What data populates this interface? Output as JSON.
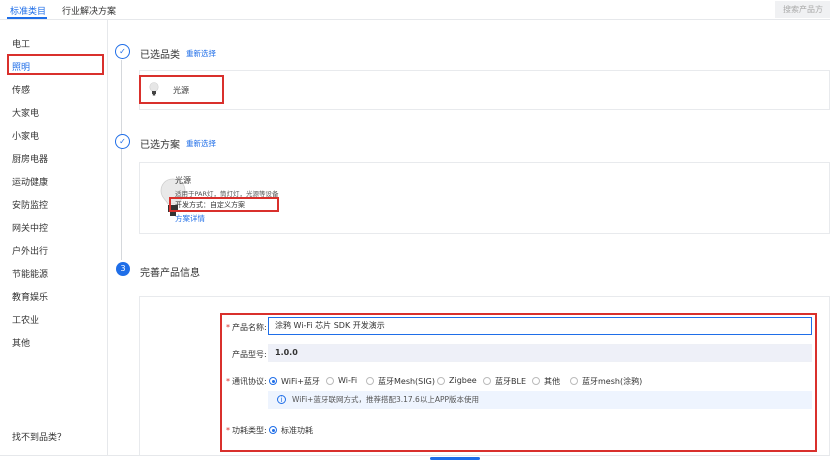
{
  "tabs": [
    {
      "label": "标准类目",
      "active": true
    },
    {
      "label": "行业解决方案",
      "active": false
    }
  ],
  "search": {
    "placeholder": "搜索产品方"
  },
  "sidebar": {
    "items": [
      {
        "label": "电工"
      },
      {
        "label": "照明",
        "active": true
      },
      {
        "label": "传感"
      },
      {
        "label": "大家电"
      },
      {
        "label": "小家电"
      },
      {
        "label": "厨房电器"
      },
      {
        "label": "运动健康"
      },
      {
        "label": "安防监控"
      },
      {
        "label": "网关中控"
      },
      {
        "label": "户外出行"
      },
      {
        "label": "节能能源"
      },
      {
        "label": "教育娱乐"
      },
      {
        "label": "工农业"
      },
      {
        "label": "其他"
      }
    ],
    "bottom": "找不到品类？"
  },
  "step1": {
    "title": "已选品类",
    "link": "重新选择",
    "selected": "光源"
  },
  "step2": {
    "title": "已选方案",
    "link": "重新选择",
    "name": "光源",
    "desc": "适用于PAR灯，筒灯灯，光源等设备",
    "dev_mode": "开发方式：自定义方案",
    "detail_link": "方案详情"
  },
  "step3": {
    "number": "3",
    "title": "完善产品信息"
  },
  "form": {
    "name_label": "产品名称:",
    "name_value": "涂鸦 Wi-Fi 芯片 SDK 开发演示",
    "model_label": "产品型号:",
    "model_value": "1.0.0",
    "protocol_label": "通讯协议:",
    "protocols": [
      {
        "label": "WiFi+蓝牙",
        "checked": true
      },
      {
        "label": "Wi-Fi",
        "checked": false
      },
      {
        "label": "蓝牙Mesh(SIG)",
        "checked": false
      },
      {
        "label": "Zigbee",
        "checked": false
      },
      {
        "label": "蓝牙BLE",
        "checked": false
      },
      {
        "label": "其他",
        "checked": false
      },
      {
        "label": "蓝牙mesh(涂鸦)",
        "checked": false
      }
    ],
    "info_text": "WiFi+蓝牙联网方式，推荐搭配3.17.6以上APP版本使用",
    "power_label": "功耗类型:",
    "power_option": "标准功耗"
  },
  "colors": {
    "accent": "#1f6ee8",
    "highlight": "#d9302c"
  }
}
